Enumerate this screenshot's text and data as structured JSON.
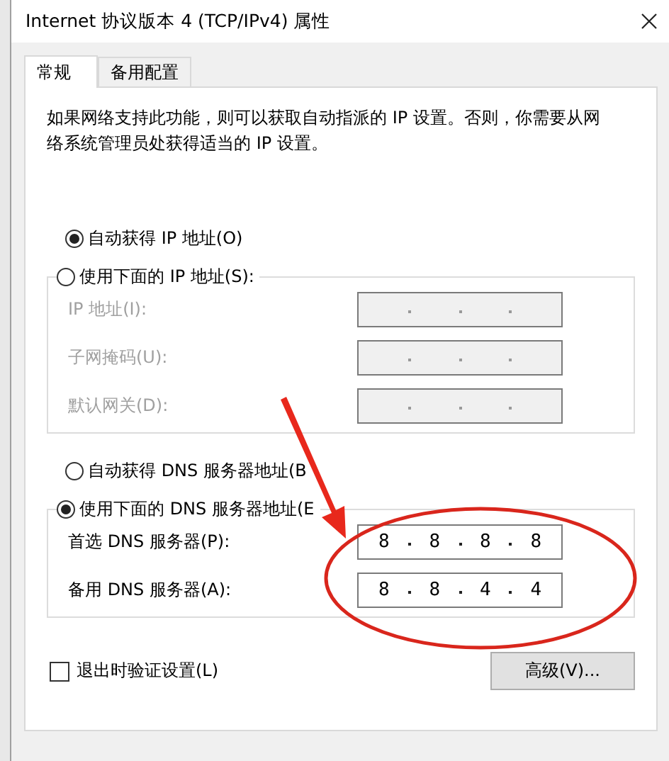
{
  "window": {
    "title": "Internet 协议版本 4 (TCP/IPv4) 属性"
  },
  "tabs": [
    {
      "label": "常规",
      "selected": true
    },
    {
      "label": "备用配置",
      "selected": false
    }
  ],
  "description": "如果网络支持此功能，则可以获取自动指派的 IP 设置。否则，你需要从网络系统管理员处获得适当的 IP 设置。",
  "ip_mode": [
    {
      "label": "自动获得 IP 地址(O)",
      "selected": true
    },
    {
      "label": "使用下面的 IP 地址(S):",
      "selected": false
    }
  ],
  "ip_fields": [
    {
      "label": "IP 地址(I):",
      "disabled": true
    },
    {
      "label": "子网掩码(U):",
      "disabled": true
    },
    {
      "label": "默认网关(D):",
      "disabled": true
    }
  ],
  "dns_mode": [
    {
      "label": "自动获得 DNS 服务器地址(B",
      "selected": false
    },
    {
      "label": "使用下面的 DNS 服务器地址(E",
      "selected": true
    }
  ],
  "dns_fields": [
    {
      "label": "首选 DNS 服务器(P):",
      "disabled": false,
      "octets": [
        "8",
        "8",
        "8",
        "8"
      ]
    },
    {
      "label": "备用 DNS 服务器(A):",
      "disabled": false,
      "octets": [
        "8",
        "8",
        "4",
        "4"
      ]
    }
  ],
  "validate": {
    "label": "退出时验证设置(L)",
    "checked": false
  },
  "advanced_button": "高级(V)..."
}
